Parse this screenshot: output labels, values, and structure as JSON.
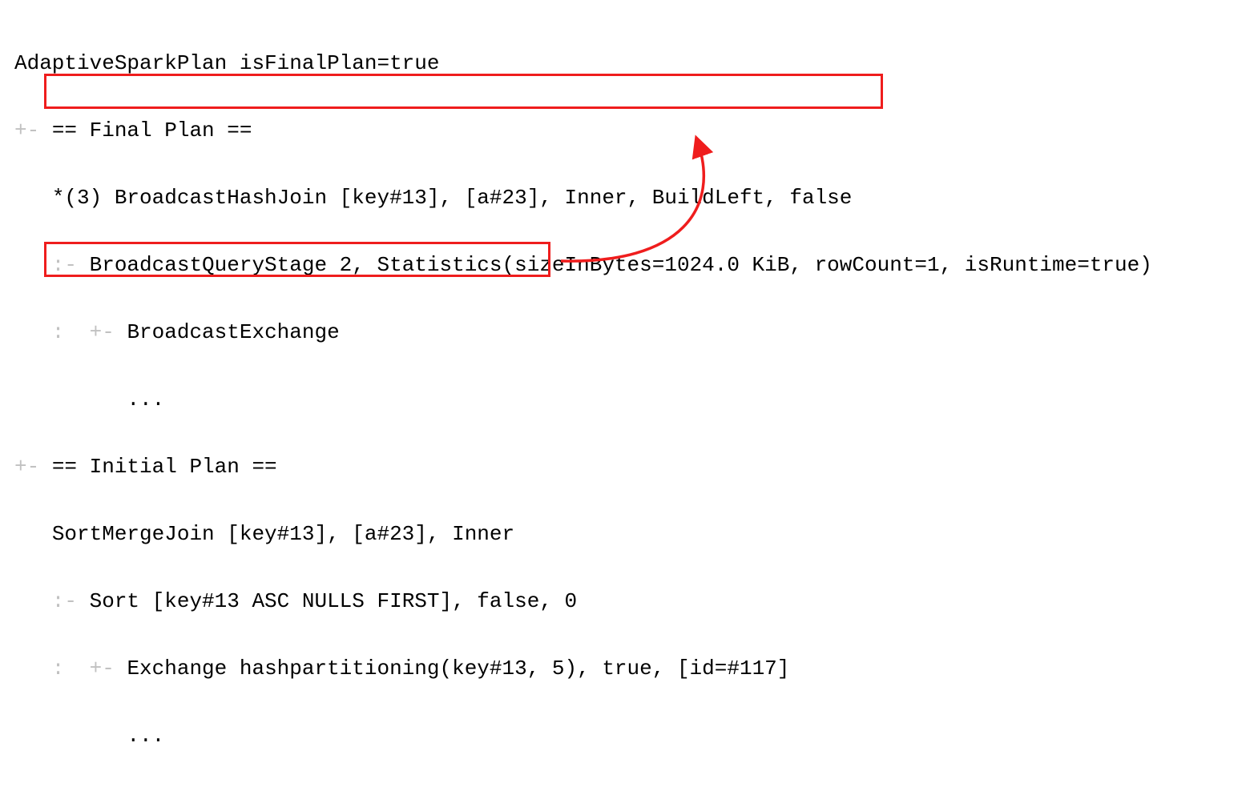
{
  "lines": {
    "l1": "AdaptiveSparkPlan isFinalPlan=true",
    "l2a": "+- ",
    "l2b": "== Final Plan ==",
    "l3a": "   ",
    "l3b": "*(3) BroadcastHashJoin [key#13], [a#23], Inner, BuildLeft, false",
    "l4a": "   :- ",
    "l4b": "BroadcastQueryStage 2, Statistics(sizeInBytes=1024.0 KiB, rowCount=1, isRuntime=true)",
    "l5a": "   :  +- ",
    "l5b": "BroadcastExchange",
    "l6a": "         ",
    "l6b": "...",
    "l7a": "+- ",
    "l7b": "== Initial Plan ==",
    "l8a": "   ",
    "l8b": "SortMergeJoin [key#13], [a#23], Inner",
    "l9a": "   :- ",
    "l9b": "Sort [key#13 ASC NULLS FIRST], false, 0",
    "l10a": "   :  +- ",
    "l10b": "Exchange hashpartitioning(key#13, 5), true, [id=#117]",
    "l11a": "         ",
    "l11b": "..."
  },
  "annotations": {
    "highlight_color": "#ef1d1d",
    "arrow_color": "#ef1d1d"
  }
}
